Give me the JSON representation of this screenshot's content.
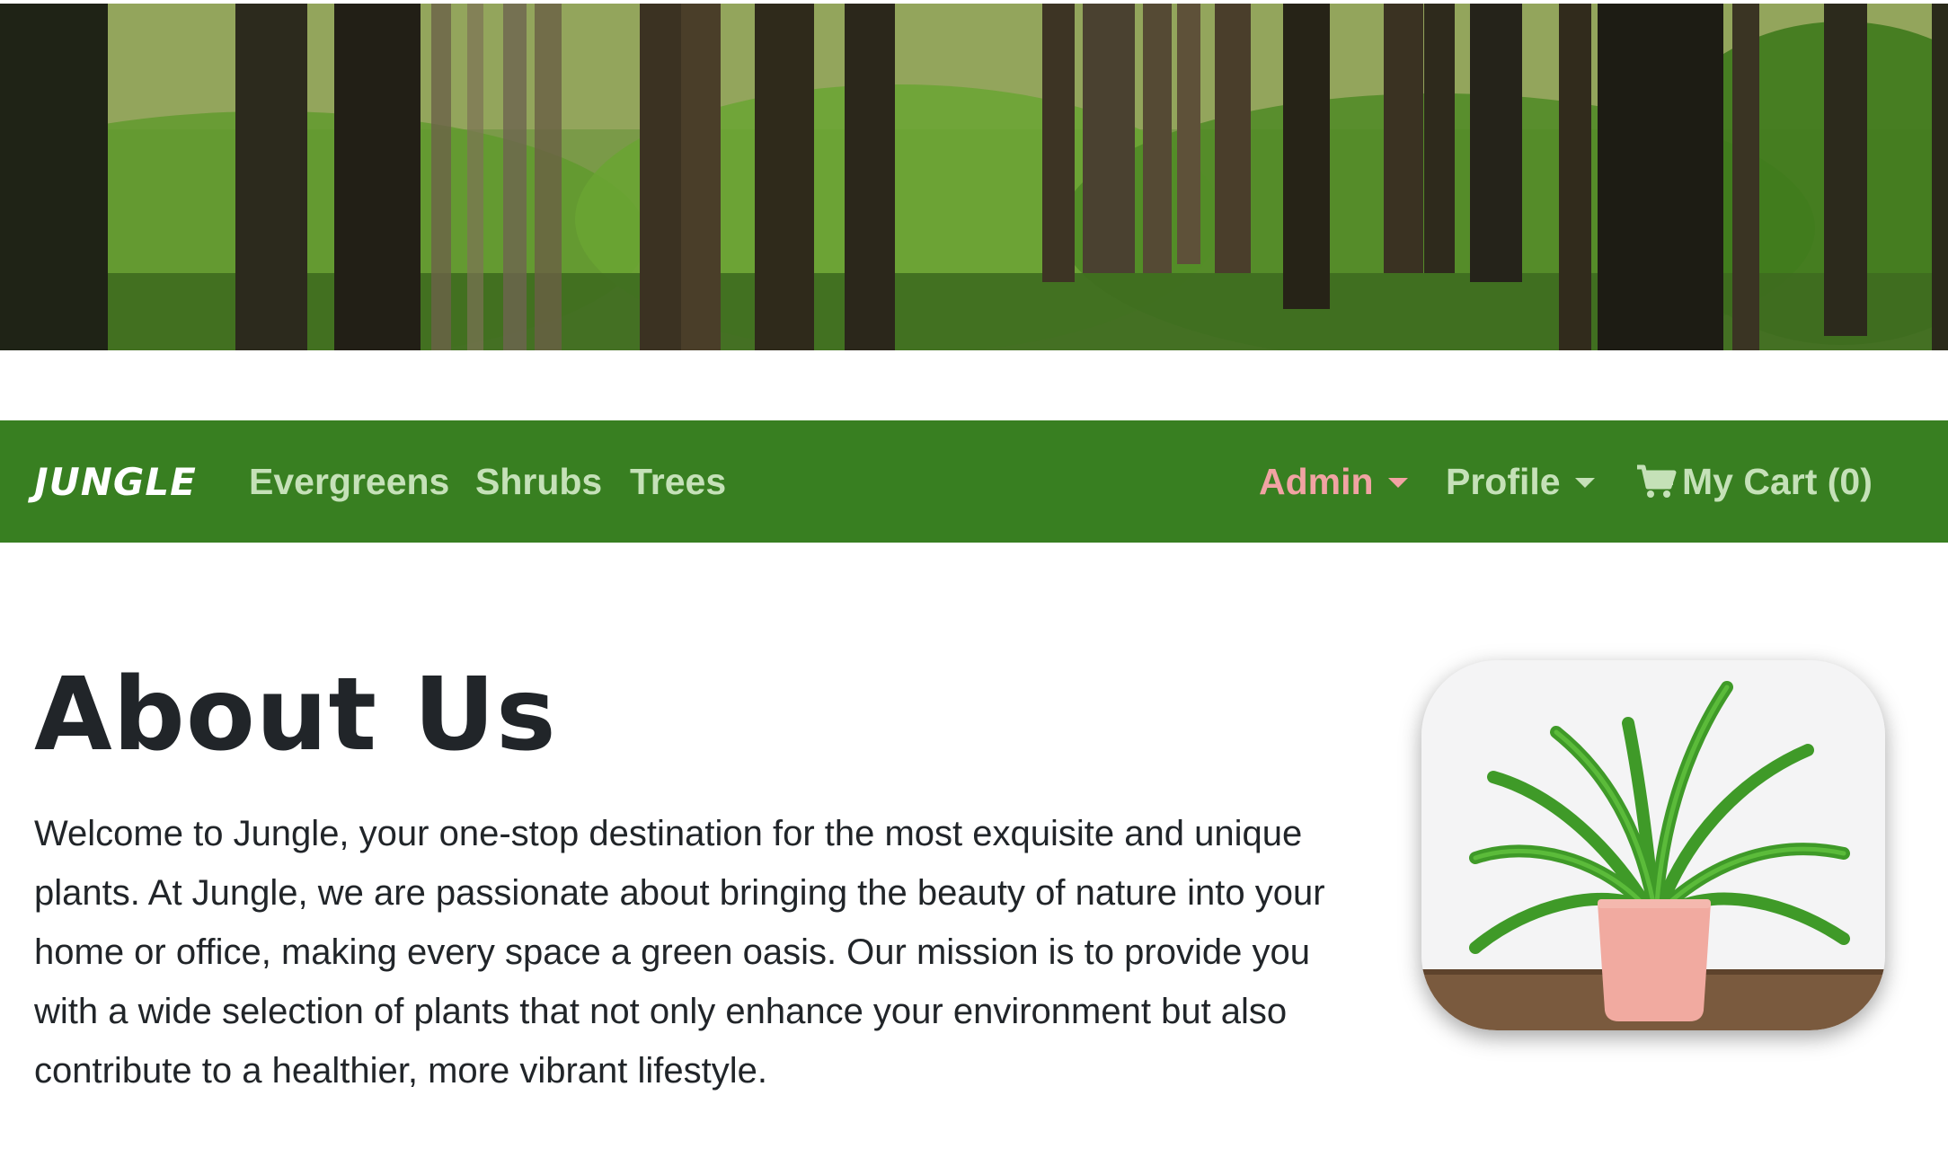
{
  "banner": {
    "icon": "forest-banner-image"
  },
  "navbar": {
    "brand": "JUNGLE",
    "links": [
      {
        "label": "Evergreens"
      },
      {
        "label": "Shrubs"
      },
      {
        "label": "Trees"
      }
    ],
    "right": {
      "admin": "Admin",
      "profile": "Profile",
      "cart_label": "My Cart (0)",
      "cart_icon": "cart-icon"
    },
    "colors": {
      "background": "#387f21",
      "link": "#c5e1b8",
      "admin": "#f1a3a3",
      "brand": "#ffffff"
    }
  },
  "about": {
    "title": "About Us",
    "paragraph_lines": [
      "Welcome to Jungle, your one-stop destination for the most exquisite and unique",
      "plants. At Jungle, we are passionate about bringing the beauty of nature into your",
      "home or office, making every space a green oasis. Our mission is to provide you",
      "with a wide selection of plants that not only enhance your environment but also",
      "contribute to a healthier, more vibrant lifestyle."
    ],
    "image_icon": "potted-fern-image"
  }
}
